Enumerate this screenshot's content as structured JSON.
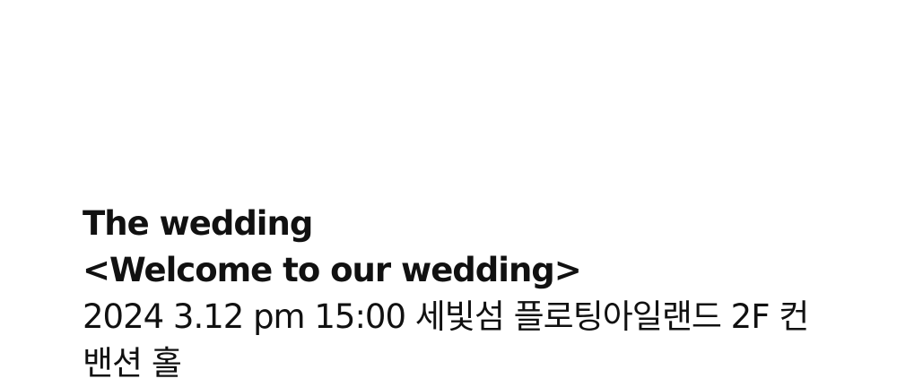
{
  "invitation": {
    "title": "The wedding",
    "subtitle": "<Welcome to our wedding>",
    "details": "2024 3.12 pm 15:00 세빛섬 플로팅아일랜드 2F 컨밴션 홀"
  },
  "colors": {
    "background": "#ffffff",
    "text": "#111111"
  }
}
